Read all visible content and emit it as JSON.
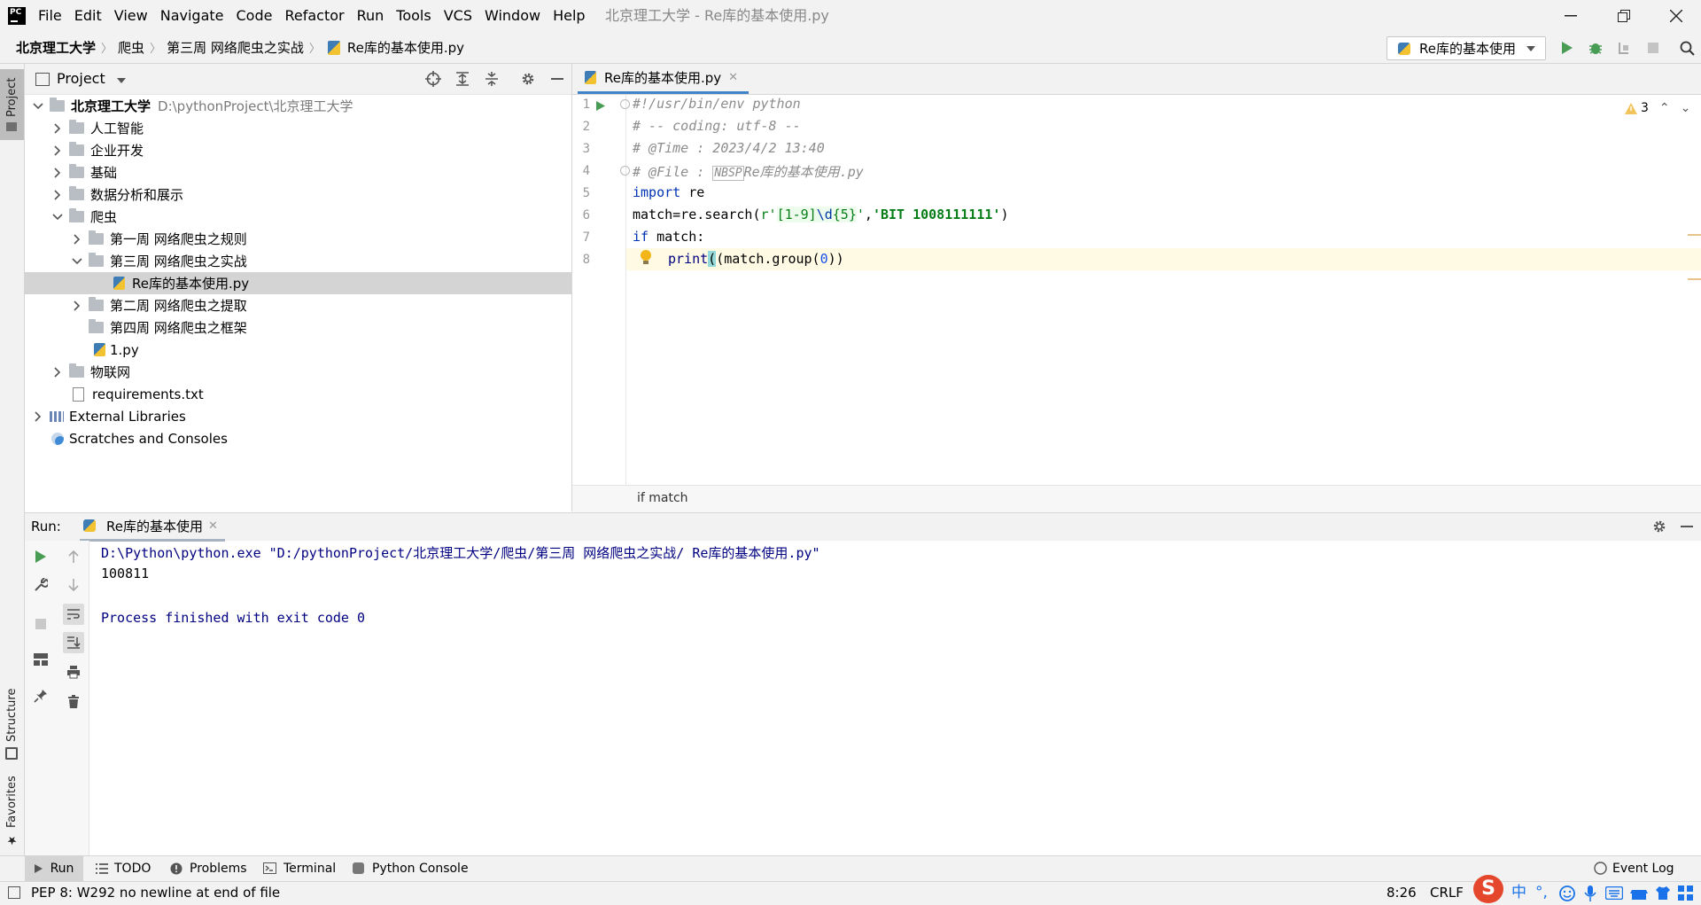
{
  "menu": [
    "File",
    "Edit",
    "View",
    "Navigate",
    "Code",
    "Refactor",
    "Run",
    "Tools",
    "VCS",
    "Window",
    "Help"
  ],
  "window_title": "北京理工大学 - Re库的基本使用.py",
  "breadcrumb": [
    "北京理工大学",
    "爬虫",
    "第三周 网络爬虫之实战",
    "Re库的基本使用.py"
  ],
  "run_config": "Re库的基本使用",
  "project": {
    "title": "Project",
    "tree": [
      {
        "label": "北京理工大学",
        "hint": "D:\\pythonProject\\北京理工大学",
        "bold": true
      },
      {
        "label": "人工智能"
      },
      {
        "label": "企业开发"
      },
      {
        "label": "基础"
      },
      {
        "label": "数据分析和展示"
      },
      {
        "label": "爬虫"
      },
      {
        "label": "第一周 网络爬虫之规则"
      },
      {
        "label": "第三周 网络爬虫之实战"
      },
      {
        "label": "Re库的基本使用.py"
      },
      {
        "label": "第二周 网络爬虫之提取"
      },
      {
        "label": "第四周 网络爬虫之框架"
      },
      {
        "label": "1.py"
      },
      {
        "label": "物联网"
      },
      {
        "label": "requirements.txt"
      },
      {
        "label": "External Libraries"
      },
      {
        "label": "Scratches and Consoles"
      }
    ]
  },
  "editor": {
    "tab": "Re库的基本使用.py",
    "warnings": "3",
    "line_numbers": [
      "1",
      "2",
      "3",
      "4",
      "5",
      "6",
      "7",
      "8"
    ],
    "lines": {
      "l1": "#!/usr/bin/env python",
      "l2": "# -- coding: utf-8 --",
      "l3": "# @Time : 2023/4/2 13:40",
      "l4_a": "# @File : ",
      "l4_nbsp": "NBSP",
      "l4_b": "Re库的基本使用.py",
      "l5_kw": "import",
      "l5_rest": " re",
      "l6_a": "match=re.search(",
      "l6_r": "r'",
      "l6_b": "[1-9]",
      "l6_esc": "\\d",
      "l6_c": "{5}",
      "l6_d": "'",
      "l6_comma": ",",
      "l6_str": "'BIT 1008111111'",
      "l6_end": ")",
      "l7_kw": "if",
      "l7_rest": " match:",
      "l8_fn": "print",
      "l8_a": "(match.group(",
      "l8_num": "0",
      "l8_b": "))"
    },
    "breadcrumb": "if match"
  },
  "run": {
    "label": "Run:",
    "tab": "Re库的基本使用",
    "console": [
      "D:\\Python\\python.exe \"D:/pythonProject/北京理工大学/爬虫/第三周 网络爬虫之实战/ Re库的基本使用.py\"",
      "100811",
      "",
      "Process finished with exit code 0"
    ]
  },
  "left_strip": [
    "Project",
    "Structure",
    "Favorites"
  ],
  "bottom_tabs": [
    "Run",
    "TODO",
    "Problems",
    "Terminal",
    "Python Console"
  ],
  "event_log": "Event Log",
  "status": {
    "message": "PEP 8: W292 no newline at end of file",
    "position": "8:26",
    "line_sep": "CRLF",
    "ime": "中"
  },
  "colors": {
    "accent": "#4083c9",
    "run_green": "#499c54",
    "ime_red": "#e5472d"
  }
}
